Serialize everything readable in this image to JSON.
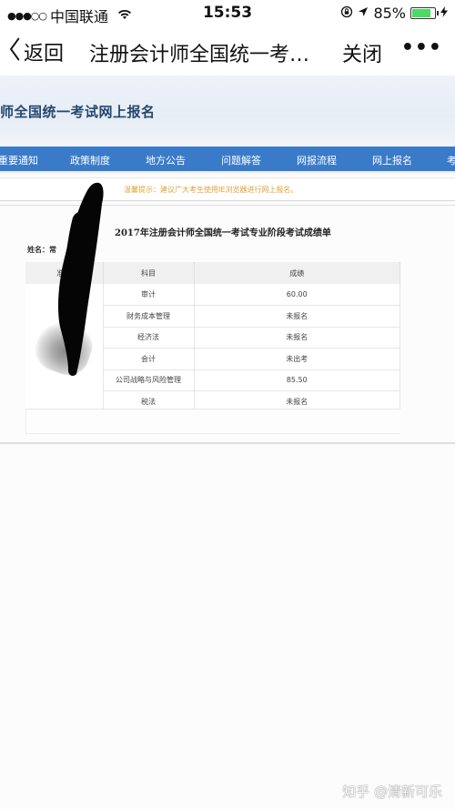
{
  "status_bar": {
    "signal": "●●●○○",
    "carrier": "中国联通",
    "wifi_icon": "wifi-icon",
    "time": "15:53",
    "orientation_lock_icon": "orientation-lock-icon",
    "location_icon": "location-arrow-icon",
    "battery_percent": "85%",
    "battery_level": 0.85,
    "charging_icon": "bolt-icon"
  },
  "nav_bar": {
    "back_label": "返回",
    "title": "注册会计师全国统一考…",
    "close_label": "关闭",
    "more_label": "•••",
    "load_progress": 0.9
  },
  "site": {
    "header_title": "师全国统一考试网上报名",
    "menu": [
      "重要通知",
      "政策制度",
      "地方公告",
      "问题解答",
      "网报流程",
      "网上报名",
      "考"
    ],
    "notice": "温馨提示：建议广大考生使用IE浏览器进行网上报名。"
  },
  "score_sheet": {
    "title": "2017年注册会计师全国统一考试专业阶段考试成绩单",
    "name_label": "姓名：常",
    "columns": [
      "准考",
      "科目",
      "成绩"
    ],
    "rows": [
      {
        "subject": "审计",
        "score": "60.00"
      },
      {
        "subject": "财务成本管理",
        "score": "未报名"
      },
      {
        "subject": "经济法",
        "score": "未报名"
      },
      {
        "subject": "会计",
        "score": "未出考"
      },
      {
        "subject": "公司战略与风险管理",
        "score": "85.50"
      },
      {
        "subject": "税法",
        "score": "未报名"
      }
    ]
  },
  "watermark": "知乎 @清新可乐"
}
